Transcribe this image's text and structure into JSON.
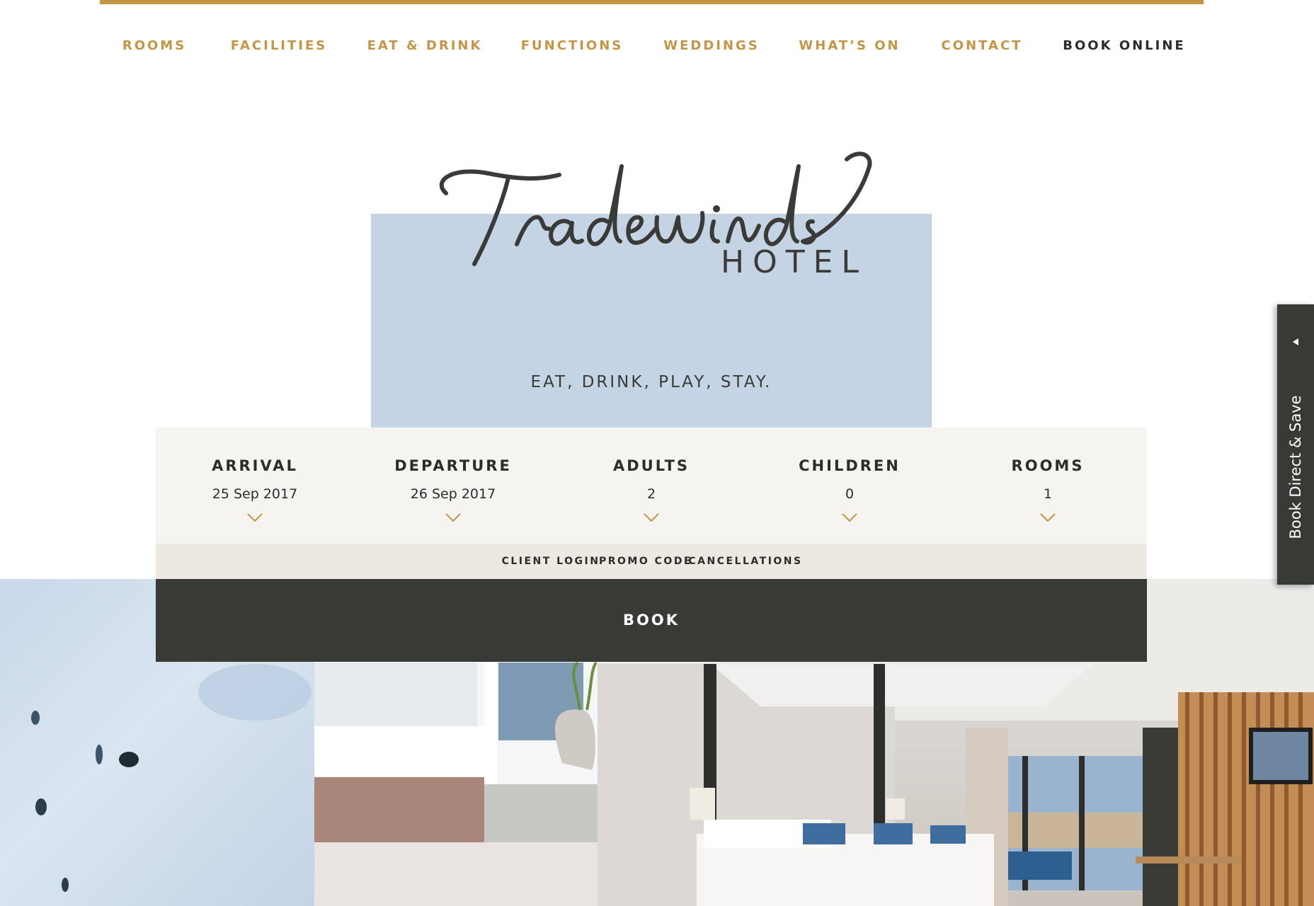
{
  "brand": {
    "accent_color": "#c59545",
    "dark_color": "#383a36",
    "hero_color": "#c5d4e4",
    "logo_script": "Tradewinds",
    "logo_sub": "HOTEL",
    "tagline": "EAT, DRINK, PLAY, STAY."
  },
  "nav": {
    "items": [
      {
        "label": "ROOMS"
      },
      {
        "label": "FACILITIES"
      },
      {
        "label": "EAT & DRINK"
      },
      {
        "label": "FUNCTIONS"
      },
      {
        "label": "WEDDINGS"
      },
      {
        "label": "WHAT’S ON"
      },
      {
        "label": "CONTACT"
      },
      {
        "label": "BOOK ONLINE"
      }
    ]
  },
  "booking": {
    "fields": [
      {
        "label": "ARRIVAL",
        "value": "25 Sep 2017",
        "icon": "chevron-down-icon"
      },
      {
        "label": "DEPARTURE",
        "value": "26 Sep 2017",
        "icon": "chevron-down-icon"
      },
      {
        "label": "ADULTS",
        "value": "2",
        "icon": "chevron-down-icon"
      },
      {
        "label": "CHILDREN",
        "value": "0",
        "icon": "chevron-down-icon"
      },
      {
        "label": "ROOMS",
        "value": "1",
        "icon": "chevron-down-icon"
      }
    ],
    "links": [
      "CLIENT LOGIN",
      "PROMO CODE",
      "CANCELLATIONS"
    ],
    "book_label": "BOOK"
  },
  "side_tab": {
    "label": "Book Direct & Save",
    "icon": "caret-left-icon"
  }
}
